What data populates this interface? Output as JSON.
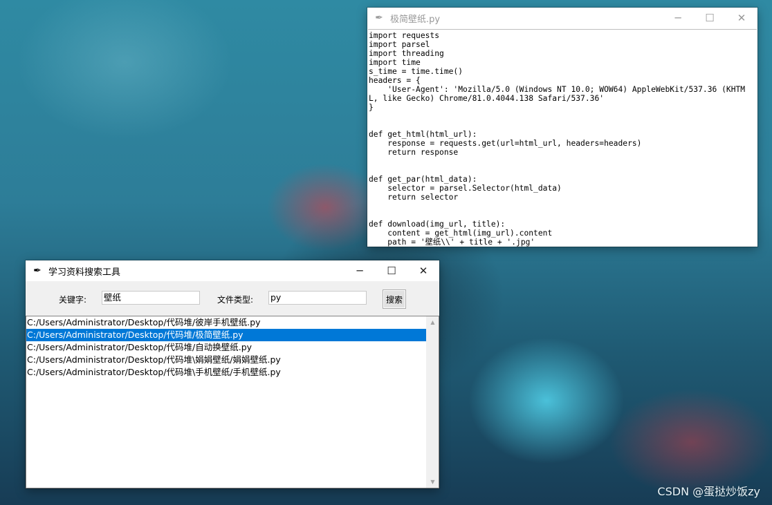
{
  "editor_window": {
    "title": "极简壁纸.py",
    "icon": "feather-icon",
    "code_lines": [
      "import requests",
      "import parsel",
      "import threading",
      "import time",
      "s_time = time.time()",
      "headers = {",
      "    'User-Agent': 'Mozilla/5.0 (Windows NT 10.0; WOW64) AppleWebKit/537.36 (KHTM",
      "L, like Gecko) Chrome/81.0.4044.138 Safari/537.36'",
      "}",
      "",
      "",
      "def get_html(html_url):",
      "    response = requests.get(url=html_url, headers=headers)",
      "    return response",
      "",
      "",
      "def get_par(html_data):",
      "    selector = parsel.Selector(html_data)",
      "    return selector",
      "",
      "",
      "def download(img_url, title):",
      "    content = get_html(img_url).content",
      "    path = '壁纸\\\\' + title + '.jpg'"
    ]
  },
  "tool_window": {
    "title": "学习资料搜索工具",
    "icon": "feather-icon",
    "keyword_label": "关键字:",
    "keyword_value": "壁纸",
    "filetype_label": "文件类型:",
    "filetype_value": "py",
    "search_button": "搜索",
    "results": [
      "C:/Users/Administrator/Desktop/代码堆/彼岸手机壁纸.py",
      "C:/Users/Administrator/Desktop/代码堆/极简壁纸.py",
      "C:/Users/Administrator/Desktop/代码堆/自动换壁纸.py",
      "C:/Users/Administrator/Desktop/代码堆\\娟娟壁纸/娟娟壁纸.py",
      "C:/Users/Administrator/Desktop/代码堆\\手机壁纸/手机壁纸.py"
    ],
    "selected_index": 1,
    "selection_color": "#0078d7"
  },
  "window_controls": {
    "minimize": "─",
    "maximize": "☐",
    "close": "✕"
  },
  "watermark": "CSDN @蛋挞炒饭zy"
}
